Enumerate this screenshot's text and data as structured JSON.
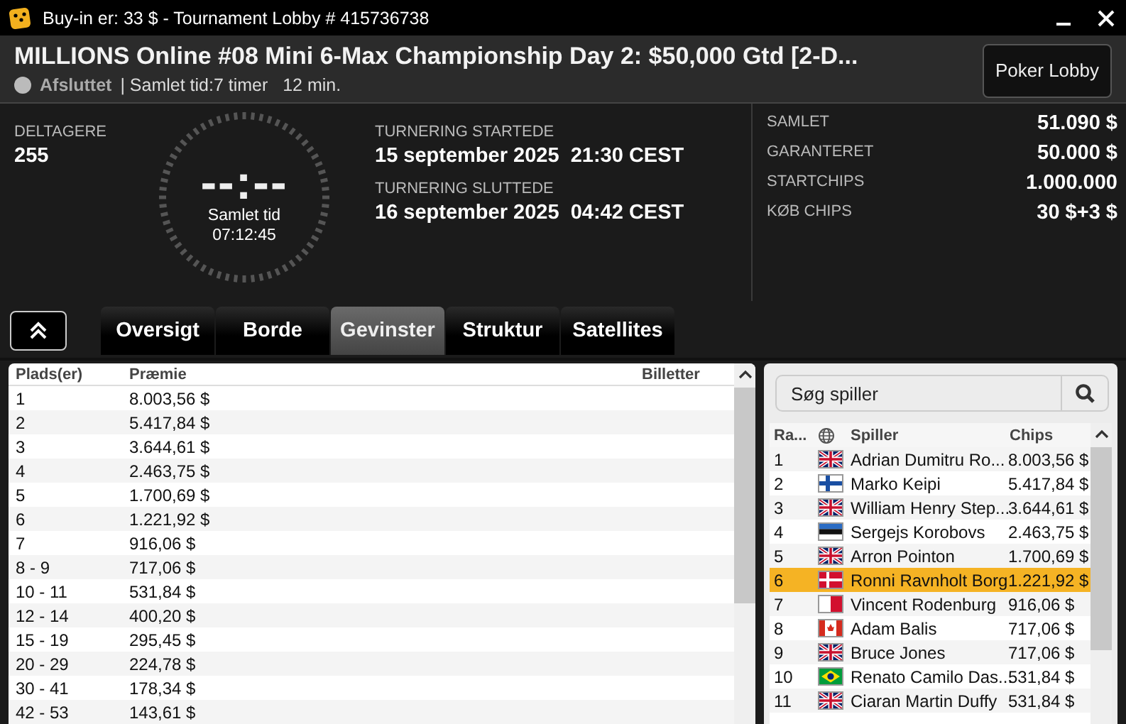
{
  "window": {
    "title": "Buy-in er: 33 $ - Tournament Lobby # 415736738"
  },
  "header": {
    "title": "MILLIONS Online #08 Mini 6-Max Championship Day 2: $50,000 Gtd [2-D...",
    "status": "Afsluttet",
    "total_time": "| Samlet tid:7 timer   12 min.",
    "lobby_button": "Poker Lobby"
  },
  "entrants": {
    "label": "DELTAGERE",
    "value": "255"
  },
  "clock": {
    "display": "--:--",
    "label": "Samlet tid",
    "time": "07:12:45"
  },
  "dates": [
    {
      "label": "TURNERING STARTEDE",
      "value": "15 september 2025  21:30 CEST"
    },
    {
      "label": "TURNERING SLUTTEDE",
      "value": "16 september 2025  04:42 CEST"
    }
  ],
  "summary": [
    {
      "label": "SAMLET",
      "value": "51.090 $"
    },
    {
      "label": "GARANTERET",
      "value": "50.000 $"
    },
    {
      "label": "STARTCHIPS",
      "value": "1.000.000"
    },
    {
      "label": "KØB CHIPS",
      "value": "30 $+3 $"
    }
  ],
  "tabs": [
    {
      "label": "Oversigt",
      "selected": false
    },
    {
      "label": "Borde",
      "selected": false
    },
    {
      "label": "Gevinster",
      "selected": true
    },
    {
      "label": "Struktur",
      "selected": false
    },
    {
      "label": "Satellites",
      "selected": false
    }
  ],
  "prizes": {
    "columns": [
      "Plads(er)",
      "Præmie",
      "Billetter"
    ],
    "rows": [
      [
        "1",
        "8.003,56 $"
      ],
      [
        "2",
        "5.417,84 $"
      ],
      [
        "3",
        "3.644,61 $"
      ],
      [
        "4",
        "2.463,75 $"
      ],
      [
        "5",
        "1.700,69 $"
      ],
      [
        "6",
        "1.221,92 $"
      ],
      [
        "7",
        "916,06 $"
      ],
      [
        "8 - 9",
        "717,06 $"
      ],
      [
        "10 - 11",
        "531,84 $"
      ],
      [
        "12 - 14",
        "400,20 $"
      ],
      [
        "15 - 19",
        "295,45 $"
      ],
      [
        "20 - 29",
        "224,78 $"
      ],
      [
        "30 - 41",
        "178,34 $"
      ],
      [
        "42 - 53",
        "143,61 $"
      ]
    ]
  },
  "players": {
    "search": {
      "placeholder": "Søg spiller"
    },
    "columns": [
      "Ra...",
      "Spiller",
      "Chips"
    ],
    "rows": [
      {
        "rank": "1",
        "kind": "gb",
        "name": "Adrian Dumitru Ro...",
        "chips": "8.003,56 $",
        "selected": false
      },
      {
        "rank": "2",
        "kind": "fi",
        "name": "Marko Keipi",
        "chips": "5.417,84 $",
        "selected": false
      },
      {
        "rank": "3",
        "kind": "gb",
        "name": "William Henry Step...",
        "chips": "3.644,61 $",
        "selected": false
      },
      {
        "rank": "4",
        "kind": "ee",
        "name": "Sergejs Korobovs",
        "chips": "2.463,75 $",
        "selected": false
      },
      {
        "rank": "5",
        "kind": "gb",
        "name": "Arron Pointon",
        "chips": "1.700,69 $",
        "selected": false
      },
      {
        "rank": "6",
        "kind": "dk",
        "name": "Ronni Ravnholt Borg",
        "chips": "1.221,92 $",
        "selected": true
      },
      {
        "rank": "7",
        "kind": "mt",
        "name": "Vincent Rodenburg",
        "chips": "916,06 $",
        "selected": false
      },
      {
        "rank": "8",
        "kind": "ca",
        "name": "Adam Balis",
        "chips": "717,06 $",
        "selected": false
      },
      {
        "rank": "9",
        "kind": "gb",
        "name": "Bruce Jones",
        "chips": "717,06 $",
        "selected": false
      },
      {
        "rank": "10",
        "kind": "br",
        "name": "Renato Camilo Das...",
        "chips": "531,84 $",
        "selected": false
      },
      {
        "rank": "11",
        "kind": "gb",
        "name": "Ciaran Martin Duffy",
        "chips": "531,84 $",
        "selected": false
      }
    ]
  }
}
